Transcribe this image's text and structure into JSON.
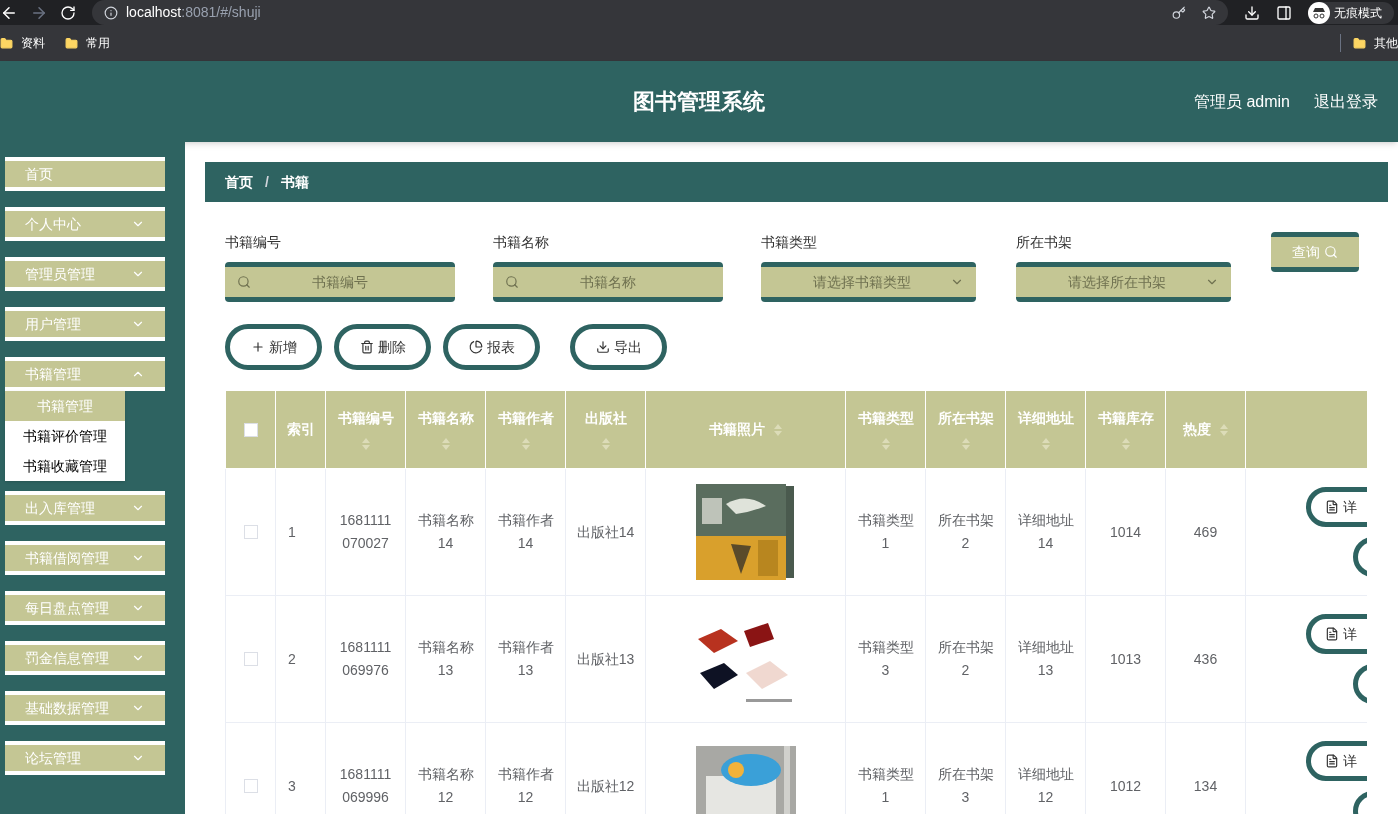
{
  "browser": {
    "url_host": "localhost",
    "url_path": ":8081/#/shuji",
    "incognito_label": "无痕模式",
    "bookmarks": [
      "资料",
      "常用"
    ],
    "other_bookmarks": "其他"
  },
  "header": {
    "title": "图书管理系统",
    "user": "管理员 admin",
    "logout": "退出登录"
  },
  "sidebar": {
    "items": [
      {
        "label": "首页",
        "expandable": false
      },
      {
        "label": "个人中心",
        "expandable": true,
        "expanded": false
      },
      {
        "label": "管理员管理",
        "expandable": true,
        "expanded": false
      },
      {
        "label": "用户管理",
        "expandable": true,
        "expanded": false
      },
      {
        "label": "书籍管理",
        "expandable": true,
        "expanded": true,
        "children": [
          {
            "label": "书籍管理",
            "selected": true
          },
          {
            "label": "书籍评价管理",
            "selected": false
          },
          {
            "label": "书籍收藏管理",
            "selected": false
          }
        ]
      },
      {
        "label": "出入库管理",
        "expandable": true,
        "expanded": false
      },
      {
        "label": "书籍借阅管理",
        "expandable": true,
        "expanded": false
      },
      {
        "label": "每日盘点管理",
        "expandable": true,
        "expanded": false
      },
      {
        "label": "罚金信息管理",
        "expandable": true,
        "expanded": false
      },
      {
        "label": "基础数据管理",
        "expandable": true,
        "expanded": false
      },
      {
        "label": "论坛管理",
        "expandable": true,
        "expanded": false
      }
    ]
  },
  "breadcrumb": {
    "items": [
      "首页",
      "书籍"
    ],
    "separator": "/"
  },
  "filters": [
    {
      "label": "书籍编号",
      "kind": "input",
      "placeholder": "书籍编号"
    },
    {
      "label": "书籍名称",
      "kind": "input",
      "placeholder": "书籍名称"
    },
    {
      "label": "书籍类型",
      "kind": "select",
      "placeholder": "请选择书籍类型"
    },
    {
      "label": "所在书架",
      "kind": "select",
      "placeholder": "请选择所在书架"
    }
  ],
  "search_button": "查询",
  "actions": [
    {
      "label": "新增",
      "kind": "plus"
    },
    {
      "label": "删除",
      "kind": "trash"
    },
    {
      "label": "报表",
      "kind": "pie"
    },
    {
      "label": "导出",
      "kind": "download"
    }
  ],
  "table": {
    "header_checkbox": {
      "checked": false
    },
    "columns": [
      {
        "label": "索引",
        "sortable": false
      },
      {
        "label": "书籍编号",
        "sortable": true
      },
      {
        "label": "书籍名称",
        "sortable": true
      },
      {
        "label": "书籍作者",
        "sortable": true
      },
      {
        "label": "出版社",
        "sortable": true
      },
      {
        "label": "书籍照片",
        "sortable": true
      },
      {
        "label": "书籍类型",
        "sortable": true
      },
      {
        "label": "所在书架",
        "sortable": true
      },
      {
        "label": "详细地址",
        "sortable": true
      },
      {
        "label": "书籍库存",
        "sortable": true
      },
      {
        "label": "热度",
        "sortable": true
      }
    ],
    "rows": [
      {
        "checked": false,
        "cells": [
          "1",
          "1681111 070027",
          "书籍名称 14",
          "书籍作者 14",
          "出版社14"
        ],
        "cells2": [
          "书籍类型 1",
          "所在书架 2",
          "详细地址 14",
          "1014",
          "469"
        ],
        "action": "详"
      },
      {
        "checked": false,
        "cells": [
          "2",
          "1681111 069976",
          "书籍名称 13",
          "书籍作者 13",
          "出版社13"
        ],
        "cells2": [
          "书籍类型 3",
          "所在书架 2",
          "详细地址 13",
          "1013",
          "436"
        ],
        "action": "详"
      },
      {
        "checked": false,
        "cells": [
          "3",
          "1681111 069996",
          "书籍名称 12",
          "书籍作者 12",
          "出版社12"
        ],
        "cells2": [
          "书籍类型 1",
          "所在书架 3",
          "详细地址 12",
          "1012",
          "134"
        ],
        "action": "详"
      }
    ]
  }
}
